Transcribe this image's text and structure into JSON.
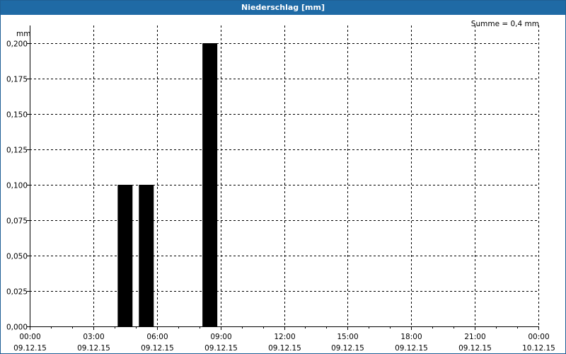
{
  "window": {
    "title": "Niederschlag [mm]"
  },
  "chart_data": {
    "type": "bar",
    "title": "Niederschlag [mm]",
    "ylabel": "mm",
    "annotation": "Summe = 0,4 mm",
    "ylim": [
      0,
      0.2
    ],
    "y_ticks": [
      "0,000",
      "0,025",
      "0,050",
      "0,075",
      "0,100",
      "0,125",
      "0,150",
      "0,175",
      "0,200"
    ],
    "x_ticks": [
      {
        "time": "00:00",
        "date": "09.12.15"
      },
      {
        "time": "03:00",
        "date": "09.12.15"
      },
      {
        "time": "06:00",
        "date": "09.12.15"
      },
      {
        "time": "09:00",
        "date": "09.12.15"
      },
      {
        "time": "12:00",
        "date": "09.12.15"
      },
      {
        "time": "15:00",
        "date": "09.12.15"
      },
      {
        "time": "18:00",
        "date": "09.12.15"
      },
      {
        "time": "21:00",
        "date": "09.12.15"
      },
      {
        "time": "00:00",
        "date": "10.12.15"
      }
    ],
    "bar_color": "#000000",
    "grid": true,
    "bars": [
      {
        "time": "09.12.15 04:30",
        "value": 0.1
      },
      {
        "time": "09.12.15 05:30",
        "value": 0.1
      },
      {
        "time": "09.12.15 08:30",
        "value": 0.2
      }
    ]
  }
}
